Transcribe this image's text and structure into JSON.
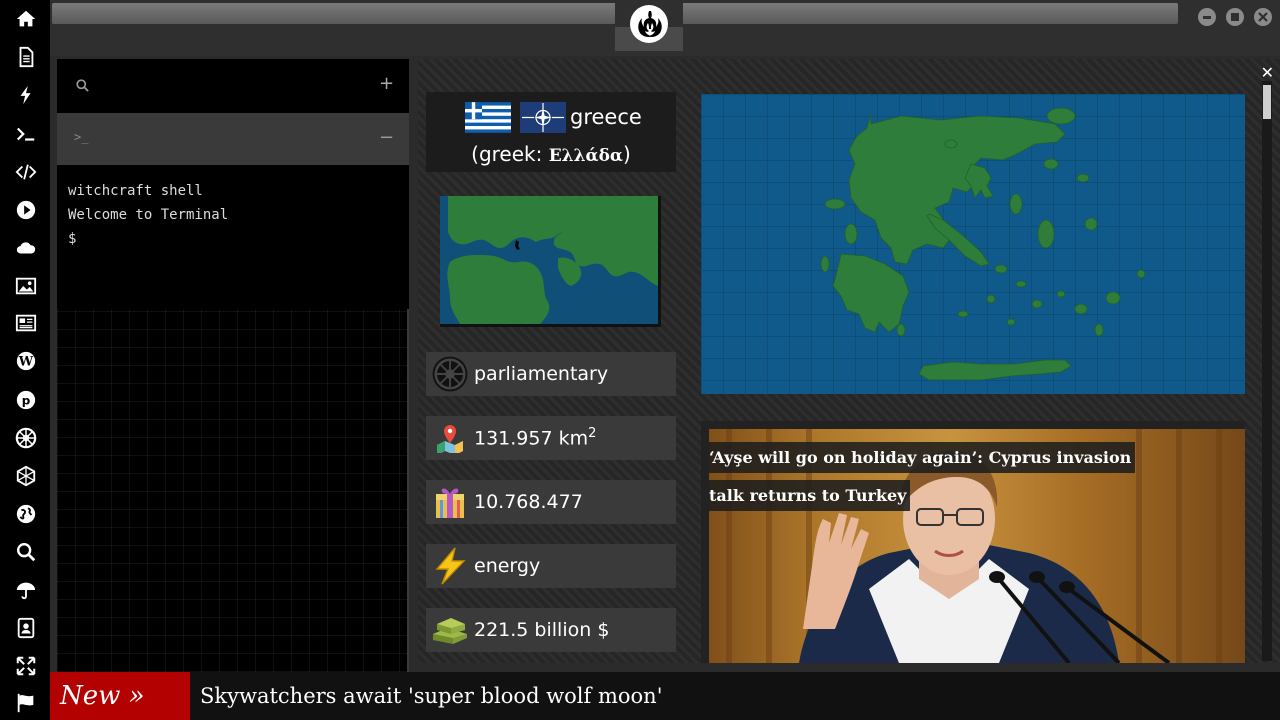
{
  "sidebar": {
    "icons": [
      "home-icon",
      "document-icon",
      "lightning-icon",
      "terminal-icon",
      "code-icon",
      "play-icon",
      "cloud-icon",
      "image-icon",
      "news-icon",
      "wordpress-icon",
      "pinterest-icon",
      "galactic-empire-icon",
      "death-star-icon",
      "globe-icon",
      "search-icon",
      "umbrella-icon",
      "contact-card-icon",
      "expand-icon",
      "flag-icon"
    ]
  },
  "terminal": {
    "title": "witchcraft shell",
    "welcome": "Welcome to Terminal",
    "prompt": "$",
    "tab_symbol": ">_",
    "add_symbol": "+",
    "minimize_symbol": "−"
  },
  "country": {
    "name": "greece",
    "native": "(greek: Ελλάδα)",
    "native_prefix": "(greek: ",
    "native_word": "Ελλάδα",
    "native_suffix": ")",
    "government": "parliamentary",
    "area_value": "131.957 km",
    "area_exp": "2",
    "population": "10.768.477",
    "economy_sector": "energy",
    "gdp": "221.5 billion $"
  },
  "news": {
    "headline": "‘Ayşe will go on holiday again’: Cyprus invasion talk returns to Turkey"
  },
  "ticker": {
    "label": "New »",
    "text": "Skywatchers await 'super blood wolf moon'"
  },
  "colors": {
    "ticker_red": "#b30000",
    "map_sea": "#0f5a8a",
    "map_land": "#2e7d3a"
  }
}
